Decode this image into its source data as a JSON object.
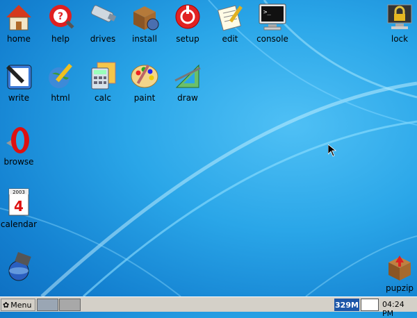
{
  "desktop": {
    "icons": [
      {
        "label": "home",
        "icon": "home-icon"
      },
      {
        "label": "help",
        "icon": "help-icon"
      },
      {
        "label": "drives",
        "icon": "drive-icon"
      },
      {
        "label": "install",
        "icon": "package-icon"
      },
      {
        "label": "setup",
        "icon": "setup-icon"
      },
      {
        "label": "edit",
        "icon": "notepad-icon"
      },
      {
        "label": "console",
        "icon": "terminal-icon"
      },
      {
        "label": "lock",
        "icon": "lock-icon"
      },
      {
        "label": "write",
        "icon": "pen-icon"
      },
      {
        "label": "html",
        "icon": "globe-pencil-icon"
      },
      {
        "label": "calc",
        "icon": "calculator-icon"
      },
      {
        "label": "paint",
        "icon": "palette-icon"
      },
      {
        "label": "draw",
        "icon": "drafting-icon"
      },
      {
        "label": "browse",
        "icon": "opera-icon"
      },
      {
        "label": "calendar",
        "icon": "calendar-icon"
      },
      {
        "label": "",
        "icon": "multimedia-icon"
      },
      {
        "label": "pupzip",
        "icon": "archive-icon"
      }
    ],
    "calendar_icon_text": {
      "year": "2003",
      "day": "4"
    },
    "console_prompt": ">_"
  },
  "taskbar": {
    "menu_label": "Menu",
    "memory": "329M",
    "clock": "04:24 PM"
  },
  "colors": {
    "desktop_bg": "#2aa6e8",
    "taskbar_bg": "#d4d0c8",
    "memory_bg": "#1c56a8"
  }
}
